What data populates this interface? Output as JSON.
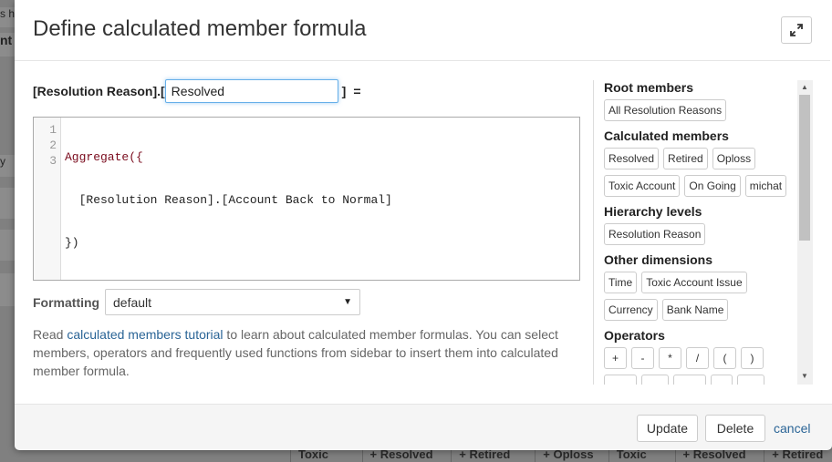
{
  "background": {
    "strip_texts": [
      "s hi",
      "nt",
      "y"
    ],
    "footer_columns": [
      "Toxic",
      "+ Resolved",
      "+ Retired",
      "+ Oploss",
      "Toxic",
      "+ Resolved",
      "+ Retired"
    ]
  },
  "modal": {
    "title": "Define calculated member formula",
    "expand_icon": "expand-icon"
  },
  "form": {
    "prefix": "[Resolution Reason].[",
    "name_value": "Resolved",
    "suffix": "]",
    "equals": "=",
    "code_lines": [
      {
        "num": "1",
        "text": "Aggregate({"
      },
      {
        "num": "2",
        "text": "  [Resolution Reason].[Account Back to Normal]"
      },
      {
        "num": "3",
        "text": "})"
      }
    ],
    "formatting_label": "Formatting",
    "formatting_value": "default",
    "help_before": "Read ",
    "help_link": "calculated members tutorial",
    "help_after": " to learn about calculated member formulas. You can select members, operators and frequently used functions from sidebar to insert them into calculated member formula."
  },
  "sidebar": {
    "root_title": "Root members",
    "root_members": [
      "All Resolution Reasons"
    ],
    "calc_title": "Calculated members",
    "calc_members": [
      "Resolved",
      "Retired",
      "Oploss",
      "Toxic Account",
      "On Going",
      "michat"
    ],
    "levels_title": "Hierarchy levels",
    "levels": [
      "Resolution Reason"
    ],
    "dims_title": "Other dimensions",
    "dimensions": [
      "Time",
      "Toxic Account Issue",
      "Currency",
      "Bank Name"
    ],
    "ops_title": "Operators",
    "operators": [
      "+",
      "-",
      "*",
      "/",
      "(",
      ")"
    ]
  },
  "footer": {
    "update_label": "Update",
    "delete_label": "Delete",
    "cancel_label": "cancel"
  }
}
